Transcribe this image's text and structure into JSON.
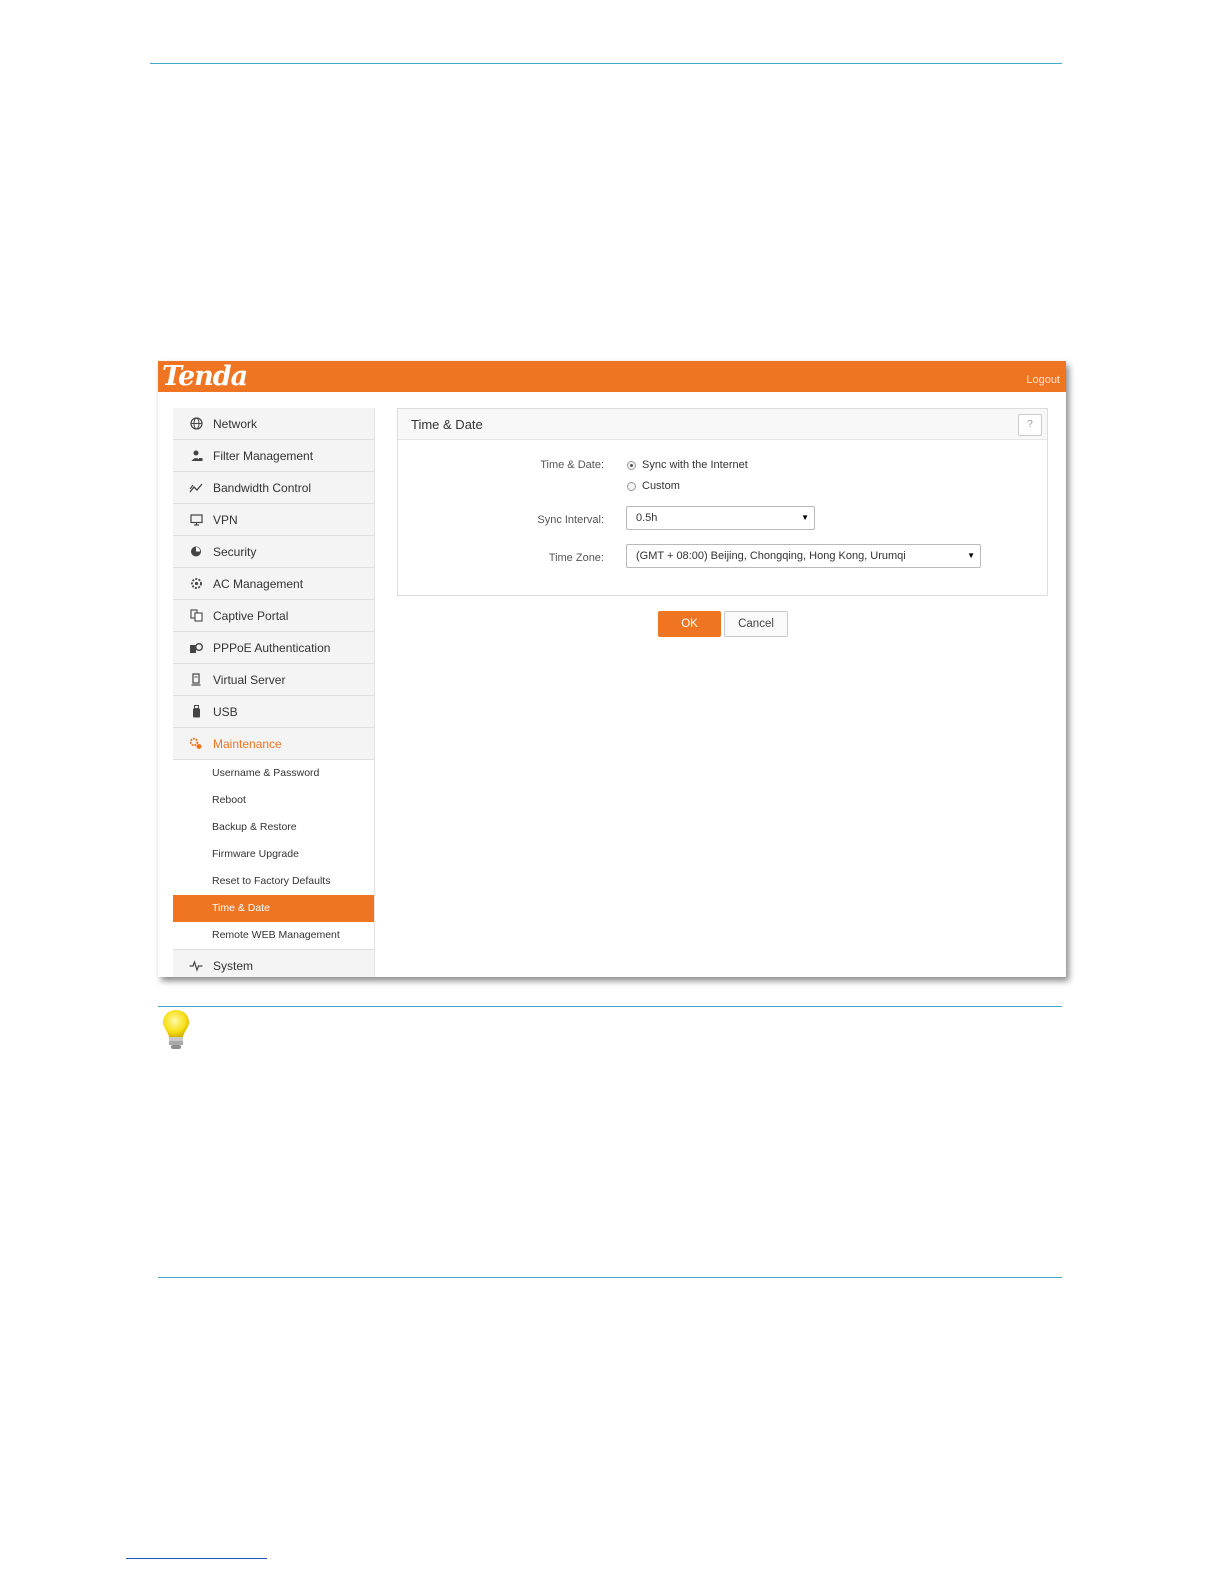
{
  "app": {
    "brand": "Tenda",
    "logout_label": "Logout"
  },
  "sidebar": {
    "items": [
      {
        "label": "Network",
        "icon": "globe-icon"
      },
      {
        "label": "Filter Management",
        "icon": "filter-user-icon"
      },
      {
        "label": "Bandwidth Control",
        "icon": "bandwidth-icon"
      },
      {
        "label": "VPN",
        "icon": "monitor-icon"
      },
      {
        "label": "Security",
        "icon": "shield-icon"
      },
      {
        "label": "AC Management",
        "icon": "ac-gear-icon"
      },
      {
        "label": "Captive Portal",
        "icon": "portal-icon"
      },
      {
        "label": "PPPoE Authentication",
        "icon": "pppoe-icon"
      },
      {
        "label": "Virtual Server",
        "icon": "server-icon"
      },
      {
        "label": "USB",
        "icon": "usb-icon"
      },
      {
        "label": "Maintenance",
        "icon": "gears-icon"
      }
    ],
    "maintenance_sub": [
      "Username & Password",
      "Reboot",
      "Backup & Restore",
      "Firmware Upgrade",
      "Reset to Factory Defaults",
      "Time & Date",
      "Remote WEB Management"
    ],
    "active_sub": "Time & Date",
    "last_item": {
      "label": "System",
      "icon": "pulse-icon"
    }
  },
  "panel": {
    "title": "Time & Date",
    "help_label": "?",
    "time_date_label": "Time & Date:",
    "option_sync": "Sync with the Internet",
    "option_custom": "Custom",
    "selected_option": "Sync with the Internet",
    "sync_interval_label": "Sync Interval:",
    "sync_interval_value": "0.5h",
    "time_zone_label": "Time Zone:",
    "time_zone_value": "(GMT + 08:00) Beijing, Chongqing, Hong Kong, Urumqi"
  },
  "actions": {
    "ok_label": "OK",
    "cancel_label": "Cancel"
  },
  "colors": {
    "accent": "#f07523",
    "rule": "#3fa9c9"
  }
}
